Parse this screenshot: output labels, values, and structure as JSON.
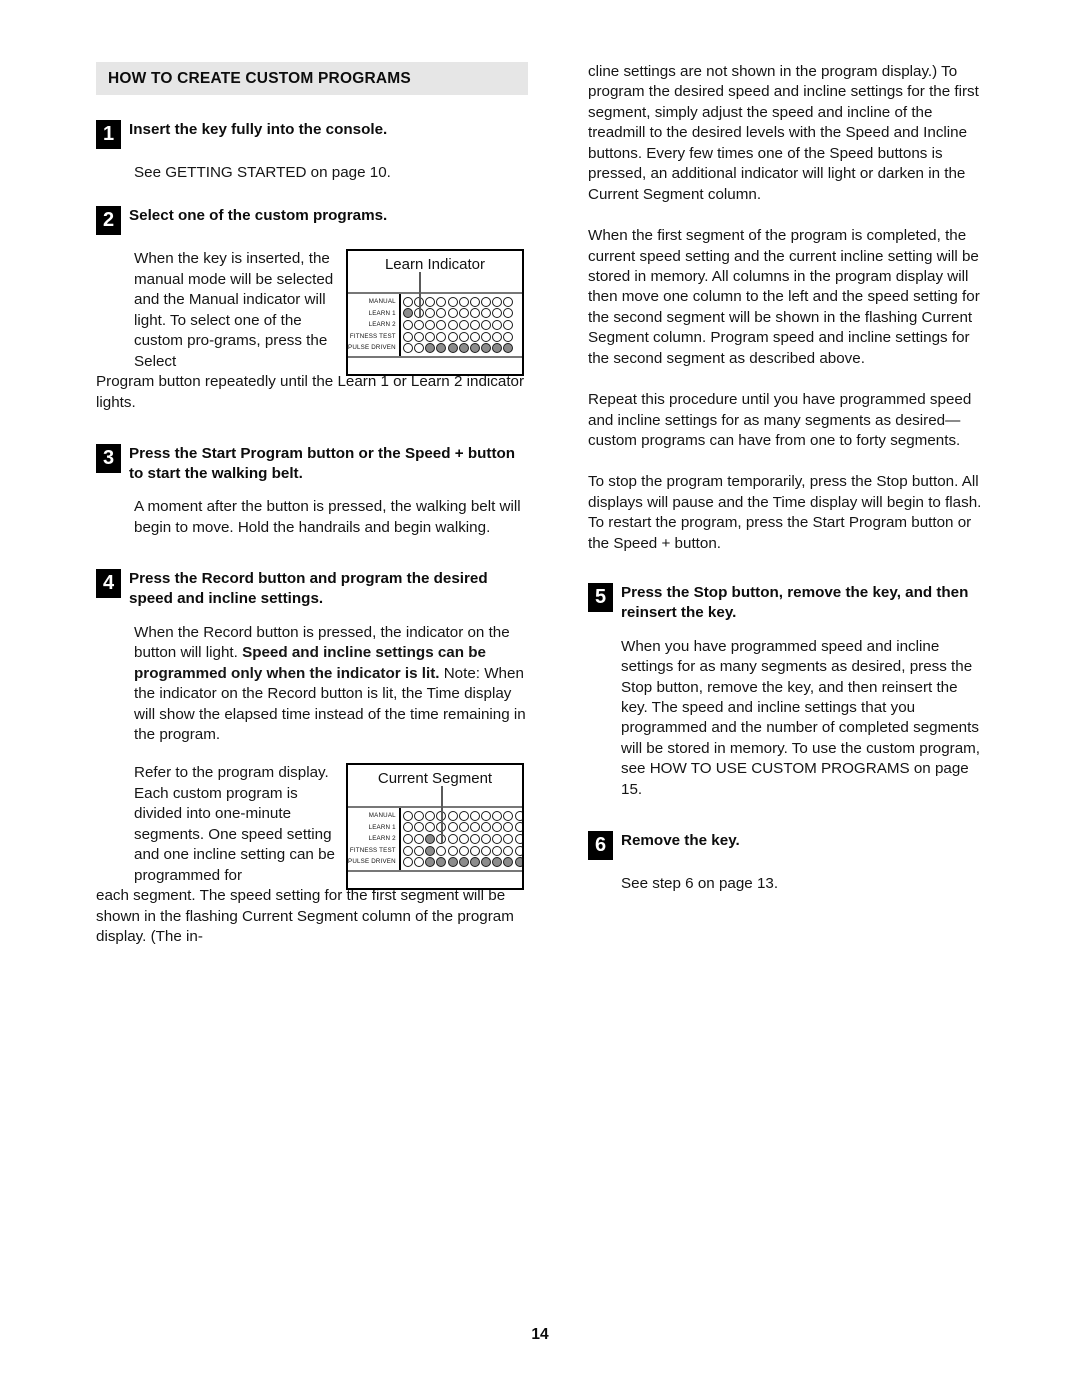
{
  "document": {
    "page_number": "14",
    "section_title": "HOW TO CREATE CUSTOM PROGRAMS"
  },
  "colors": {
    "section_bar_bg": "#e6e6e6",
    "step_box_bg": "#000000",
    "step_box_text": "#ffffff",
    "led_on": "#8c8c8c",
    "led_off": "#ffffff",
    "text": "#151515"
  },
  "left_column": {
    "steps": [
      {
        "number": "1",
        "title": "Insert the key fully into the console.",
        "body": "See GETTING STARTED on page 10."
      },
      {
        "number": "2",
        "title": "Select one of the custom programs.",
        "body_wrap": "When the key is inserted, the manual mode will be selected and the Manual indicator will light. To select one of the custom pro-grams, press the Select",
        "body_full": "Program button repeatedly until the Learn 1 or Learn 2 indicator lights."
      },
      {
        "number": "3",
        "title": "Press the Start Program button or the Speed + button to start the walking belt.",
        "body": "A moment after the button is pressed, the walking belt will begin to move. Hold the handrails and begin walking."
      },
      {
        "number": "4",
        "title": "Press the Record button and program the desired speed and incline settings.",
        "body_part1": "When the Record button is pressed, the indicator on the button will light. ",
        "body_bold": "Speed and incline settings can be programmed only when the indicator is lit.",
        "body_part2": " Note: When the indicator on the Record button is lit, the Time display will show the elapsed time instead of the time remaining in the program.",
        "body_wrap": "Refer to the program display. Each custom program is divided into one-minute segments. One speed setting and one incline setting can be programmed for",
        "body_full": "each segment. The speed setting for the first segment will be shown in the flashing Current Segment column of the program display. (The in-"
      }
    ],
    "figures": [
      {
        "caption": "Learn Indicator",
        "row_labels": [
          "MANUAL",
          "LEARN 1",
          "LEARN 2",
          "FITNESS TEST",
          "PULSE DRIVEN"
        ],
        "columns": 10,
        "arrow_column": 1,
        "arrow_target_row": 1,
        "lit": [
          [
            0,
            0,
            0,
            0,
            0,
            0,
            0,
            0,
            0,
            0
          ],
          [
            1,
            0,
            0,
            0,
            0,
            0,
            0,
            0,
            0,
            0
          ],
          [
            0,
            0,
            0,
            0,
            0,
            0,
            0,
            0,
            0,
            0
          ],
          [
            0,
            0,
            0,
            0,
            0,
            0,
            0,
            0,
            0,
            0
          ],
          [
            0,
            0,
            1,
            1,
            1,
            1,
            1,
            1,
            1,
            1
          ]
        ]
      },
      {
        "caption": "Current Segment",
        "row_labels": [
          "MANUAL",
          "LEARN 1",
          "LEARN 2",
          "FITNESS TEST",
          "PULSE DRIVEN"
        ],
        "columns": 13,
        "arrow_column": 3,
        "arrow_target_row": 2,
        "lit": [
          [
            0,
            0,
            0,
            0,
            0,
            0,
            0,
            0,
            0,
            0,
            0,
            0,
            0
          ],
          [
            0,
            0,
            0,
            0,
            0,
            0,
            0,
            0,
            0,
            0,
            0,
            0,
            0
          ],
          [
            0,
            0,
            1,
            0,
            0,
            0,
            0,
            0,
            0,
            0,
            0,
            0,
            0
          ],
          [
            0,
            0,
            1,
            0,
            0,
            0,
            0,
            0,
            0,
            0,
            0,
            0,
            0
          ],
          [
            0,
            0,
            1,
            1,
            1,
            1,
            1,
            1,
            1,
            1,
            1,
            1,
            1
          ]
        ]
      }
    ]
  },
  "right_column": {
    "paragraphs": [
      "cline settings are not shown in the program display.) To program the desired speed and incline settings for the first segment, simply adjust the speed and incline of the treadmill to the desired levels with the Speed and Incline buttons. Every few times one of the Speed buttons is pressed, an additional indicator will light or darken in the Current Segment column.",
      "When the first segment of the program is completed, the current speed setting and the current incline setting will be stored in memory. All columns in the program display will then move one column to the left and the speed setting for the second segment will be shown in the flashing Current Segment column. Program speed and incline settings for the second segment as described above.",
      "Repeat this procedure until you have programmed speed and incline settings for as many segments as desired—custom programs can have from one to forty segments.",
      "To stop the program temporarily, press the Stop button. All displays will pause and the Time display will begin to flash. To restart the program, press the Start Program button or the Speed + button."
    ],
    "steps": [
      {
        "number": "5",
        "title": "Press the Stop button, remove the key, and then reinsert the key.",
        "body": "When you have programmed speed and incline settings for as many segments as desired, press the Stop button, remove the key, and then reinsert the key. The speed and incline settings that you programmed and the number of completed segments will be stored in memory. To use the custom program, see HOW TO USE CUSTOM PROGRAMS on page 15."
      },
      {
        "number": "6",
        "title": "Remove the key.",
        "body": "See step 6 on page 13."
      }
    ]
  }
}
